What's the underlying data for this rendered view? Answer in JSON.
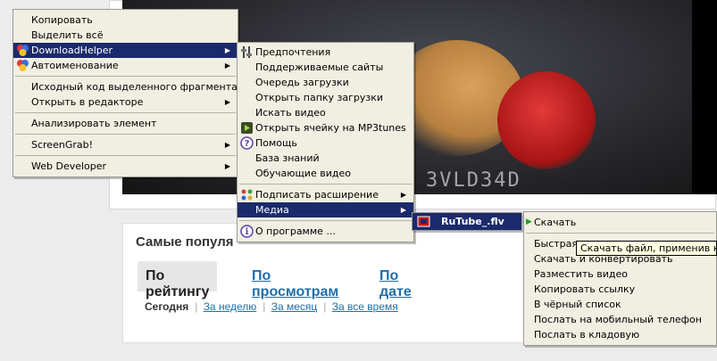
{
  "page": {
    "popular_title": "Самые популя",
    "tabs": [
      "По рейтингу",
      "По просмотрам",
      "По дате"
    ],
    "subtabs": [
      "Сегодня",
      "За неделю",
      "За месяц",
      "За все время"
    ],
    "video_watermark": "3VLD34D"
  },
  "menu1": {
    "items": [
      "Копировать",
      "Выделить всё",
      "DownloadHelper",
      "Автоименование",
      "Исходный код выделенного фрагмента",
      "Открыть в редакторе",
      "Анализировать элемент",
      "ScreenGrab!",
      "Web Developer"
    ]
  },
  "menu2": {
    "items": [
      "Предпочтения",
      "Поддерживаемые сайты",
      "Очередь загрузки",
      "Открыть папку загрузки",
      "Искать видео",
      "Открыть ячейку на MP3tunes",
      "Помощь",
      "База знаний",
      "Обучающие видео",
      "Подписать расширение",
      "Медиа",
      "О программе ..."
    ]
  },
  "menu3": {
    "items": [
      "RuTube_.flv"
    ]
  },
  "menu4": {
    "items": [
      "Скачать",
      "Быстрая загрузка",
      "Скачать и конвертировать",
      "Разместить видео",
      "Копировать ссылку",
      "В чёрный список",
      "Послать на мобильный телефон",
      "Послать в кладовую"
    ]
  },
  "tooltip": "Скачать файл, применив к нем",
  "colors": {
    "highlight": "#1b2a6b",
    "menu_bg": "#f1efe2",
    "link": "#1f6ea8"
  }
}
